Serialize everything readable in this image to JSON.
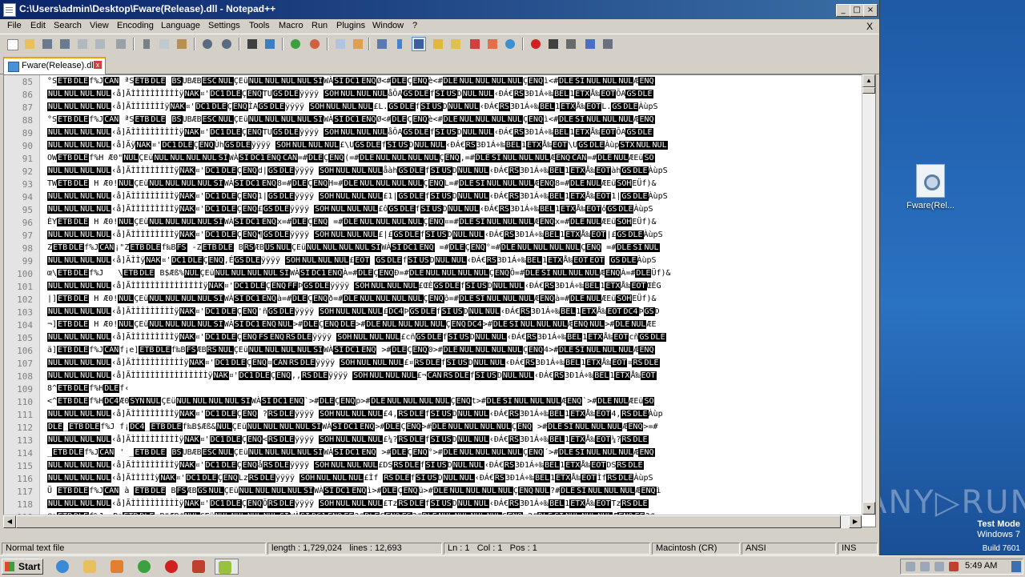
{
  "window": {
    "title": "C:\\Users\\admin\\Desktop\\Fware(Release).dll - Notepad++",
    "minimize": "_",
    "maximize": "□",
    "close": "×"
  },
  "menu": {
    "items": [
      "File",
      "Edit",
      "Search",
      "View",
      "Encoding",
      "Language",
      "Settings",
      "Tools",
      "Macro",
      "Run",
      "Plugins",
      "Window",
      "?"
    ],
    "close_doc": "X"
  },
  "toolbar": {
    "icons": [
      "new-file-icon",
      "open-file-icon",
      "save-icon",
      "save-all-icon",
      "close-icon",
      "close-all-icon",
      "print-icon",
      "cut-icon",
      "copy-icon",
      "paste-icon",
      "undo-icon",
      "redo-icon",
      "find-icon",
      "replace-icon",
      "zoom-in-icon",
      "zoom-out-icon",
      "sync-v-icon",
      "sync-h-icon",
      "wrap-icon",
      "all-chars-icon",
      "indent-guide-icon",
      "udl-icon",
      "doc-map-icon",
      "function-list-icon",
      "folder-workspace-icon",
      "monitor-icon",
      "record-macro-icon",
      "stop-record-icon",
      "play-macro-icon",
      "run-multiple-icon",
      "save-macro-icon"
    ]
  },
  "tab": {
    "name": "Fware(Release).dll",
    "close": "x"
  },
  "editor": {
    "line_numbers": [
      "85",
      "86",
      "87",
      "88",
      "89",
      "90",
      "91",
      "92",
      "93",
      "94",
      "95",
      "96",
      "97",
      "98",
      "99",
      "100",
      "101",
      "102",
      "103",
      "104",
      "105",
      "106",
      "107",
      "108",
      "109",
      "110",
      "111",
      "112",
      "113",
      "114",
      "115",
      "116",
      "117",
      "118",
      "119"
    ],
    "lines": [
      "°SETBDLEf%JCAN ªSETBDLE BSUBÆBESCNULÇEüNULNULNULNULSIWÀSIDC1ENQØ<#DLEÇENQè<#DLENULNULNULNULÇENQì<#DLESINULNULNULÆENQ",
      "NULNULNULNUL‹å]ÃÌÌÌÌÌÌÌÌÌÌÿNAK¤'DC1DLEÇENQTUGSDLEÿÿÿÿ SOHNULNULNULåÔAGSDLEfSIUSDNULNUL‹ÐÁ€RS3Ð1Á÷‰BEL1ETXÅ‰EOTÔAGSDLE",
      "NULNULNULNUL‹å]ÃÌÌÌÌÌÌÌÿNAK¤'DC1DLEÇENQÌAGSDLEÿÿÿÿ SOHNULNULNUL£L.GSDLEfSIUSDNULNUL‹ÐÁ€RS3Ð1Á÷‰BEL1ETXÅ‰EOTL.GSDLEÀùpS",
      "°SETBDLEf%JCAN ªSETBDLE BSUBÆBESCNULÇEüNULNULNULNULSIWÀSIDC1ENQØ<#DLEÇENQè<#DLENULNULNULNULÇENQì<#DLESINULNULNULÆENQ",
      "NULNULNULNUL‹å]ÃÌÌÌÌÌÌÌÌÌÌÿNAK¤'DC1DLEÇENQTUGSDLEÿÿÿÿ SOHNULNULNULåÔAGSDLEfSIUSDNULNUL‹ÐÁ€RS3Ð1Á÷‰BEL1ETXÅ‰EOTÔAGSDLE",
      "NULNULNULNUL‹å]ÃÿNAK¤'DC1DLEÇENQÙhGSDLEÿÿÿÿ SOHNULNULNUL£\\UGSDLEfSIUSDNULNUL‹ÐÁ€RS3Ð1Á÷‰BEL1ETXÅ‰EOT\\UGSDLEÀùpSTXNULNUL",
      "OWETBDLEf%H Æ0\"NULÇEüNULNULNULNULSIWÀSIDC1ENQCAN=#DLEÇENQ(=#DLENULNULNULNULÇENQ,=#DLESINULNULNULÆENQCAN=#DLENULÆEüSO",
      "NULNULNULNUL‹å]ÃÌÌÌÌÌÌÌÌÌÿNAK¤'DC1DLEÇENQd|GSDLEÿÿÿÿ SOHNULNULNULåàhGSDLEfSIUSDNULNUL‹ÐÁ€RS3Ð1Á÷‰BEL1ETXÅ‰EOTàhGSDLEÀùpS",
      "TWETBDLE H Æ0!NULÇEüNULNULNULNULSIWÀSIDC1ENQ8=#DLEÇENQH=#DLENULNULNULNULÇENQL=#DLESINULNULNULÆENQ8=#DLENULÆEüSOHEÜf)&",
      "NULNULNULNUL‹å]ÃÌÌÌÌÌÌÌÌÌÿNAK¤'DC1DLEÇENQ1|GSDLEÿÿÿÿ SOHNULNULNUL£1|GSDLEfSIUSDNULNUL‹ÐÁ€RS3Ð1Á÷‰BEL1ETXÅ‰EOT1|GSDLEÀùpS",
      "NULNULNULNUL‹å]ÃÌÌÌÌÌÌÌÌÌÿNAK¤'DC1DLEÇENQ£GSDLEÿÿÿÿ SOHNULNULNUL£ôGSDLEfSIUSDNULNUL‹ÐÁ€RS3Ð1Á÷‰BEL1ETXÅ‰EOTôGSDLEÀùpS",
      "ÈYETBDLE H Æ0!NULÇEüNULNULNULNULSIWÀSIDC1ENQx=#DLEÇENQ =#DLENULNULNULNULÇENQ¤=#DLESINULNULNULÆENQx=#DLENULÆEüSOHEÜf)&",
      "NULNULNULNUL‹å]ÃÌÌÌÌÌÌÌÌÌÿNAK¤'DC1DLEÇENQ¶GSDLEÿÿÿÿ SOHNULNULNUL£|£GSDLEfSIUSDNULNUL‹ÐÁ€RS3Ð1Á÷‰BEL1ETXÅ‰EOT|£GSDLEÀùpS",
      "ZETBDLEf%JCAN¡\"ZETBDLEf‰BFS -ZETBDLE BRSÆBUSNULÇEüNULNULNULNULSIWÀSIDC1ENQ =#DLEÇENQ°=#DLENULNULNULNULÇENQ =#DLESINUL",
      "NULNULNULNUL‹å]ÃÌÌÿNAK¤'DC1DLEÇENQ,ÉGSDLEÿÿÿÿ SOHNULNULNUL£EOT GSDLEfSIUSDNULNUL‹ÐÁ€RS3Ð1Á÷‰BEL1ETXÅ‰EOTEOT GSDLEÀùpS",
      "œ\\ETBDLEf%J   \\ETBDLE B$Æß%NULÇEüNULNULNULNULSIWÀSIDC1ENQÀ=#DLEÇENQÐ=#DLENULNULNULNULÇENQÔ=#DLESINULNULNULÆENQÀ=#DLEÜf)&",
      "NULNULNULNUL‹å]ÃÌÌÌÌÌÌÌÌÌÌÌÌÌÌÌÿNAK¤'DC1DLEÇENQFFÞGSDLEÿÿÿÿ SOHNULNULNUL£ŒÈGSDLEfSIUSDNULNUL‹ÐÁ€RS3Ð1Á÷‰BEL1ETXÅ‰EOTŒÈG",
      "|]ETBDLE H Æ0!NULÇEüNULNULNULNULSIWÀSIDC1ENQà=#DLEÇENQð=#DLENULNULNULNULÇENQô=#DLESINULNULNULÆENQà=#DLENULÆEüSOHEÜf)&",
      "NULNULNULNUL‹å]ÃÌÌÌÌÌÌÌÌÌÿNAK¤'DC1DLEÇENQ'ñGSDLEÿÿÿÿ SOHNULNULNUL£DC4ÞGSDLEfSIUSDNULNUL‹ÐÁ€RS3Ð1Á÷‰BEL1ETXÅ‰EOTDC4ÞGSD",
      "¬]ETBDLE H Æ0!NULÇEüNULNULNULNULSIWÀSIDC1ENQNUL>#DLEÇENQDLE>#DLENULNULNULNULÇENQDC4>#DLESINULNULNULÆENQNUL>#DLENULÆE",
      "NULNULNULNUL‹å]ÃÌÌÌÌÌÌÌÌÌÿNAK¤'DC1DLEÇENQFSENQRSDLEÿÿÿÿ SOHNULNULNUL£cñGSDLEfSIUSDNULNUL‹ÐÁ€RS3Ð1Á÷‰BEL1ETXÅ‰EOTcñGSDLE",
      "ä]ETBDLEf%JCANf¡e]ETBDLEf‰BFSÆBRSNULÇEüNULNULNULNULSIWÀSIDC1ENQ >#DLEÇENQ0>#DLENULNULNULNULÇENQ4>#DLESINULNULNULÆENQ",
      "NULNULNULNUL‹å]ÃÌÌÌÌÌÌÌÌÌÌÌÿNAK¤'DC1DLEÇENQ¤CANRSDLEÿÿÿÿ SOHNULNULNUL£¤RSDLEfSIUSDNULNUL‹ÐÁ€RS3Ð1Á÷‰BEL1ETXÅ‰EOT¤RSDLE",
      "NULNULNULNUL‹å]ÃÌÌÌÌÌÌÌÌÌÌÌÌÌÌÌÌÿNAK¤'DC1DLEÇENQ,,RSDLEÿÿÿÿ SOHNULNULNUL£¬CANRSDLEfSIUSDNULNUL‹ÐÁ€RS3Ð1Á÷‰BEL1ETXÅ‰EOT",
      "8^ETBDLEf%HDLEf‹",
      "<^ETBDLEf%HDC4Æ0SYNNULÇEüNULNULNULNULSIWÀSIDC1ENQ`>#DLEÇENQp>#DLENULNULNULNULÇENQt>#DLESINULNULNULÆENQ`>#DLENULÆEüSO",
      "NULNULNULNUL‹å]ÃÌÌÌÌÌÌÌÌÌÿNAK¤'DC1DLEÇENQ ?RSDLEÿÿÿÿ SOHNULNULNUL£4,RSDLEfSIUSDNULNUL‹ÐÁ€RS3Ð1Á÷‰BEL1ETXÅ‰EOT4,RSDLEÀùp",
      "DLE_ETBDLEf%J f¡DC4_ETBDLEf‰B$Æß&NULÇEüNULNULNULNULSIWÀSIDC1ENQ>#DLEÇENQ>#DLENULNULNULNULÇENQ >#DLESINULNULNULÆENQ>=#",
      "NULNULNULNUL‹å]ÃÌÌÌÌÌÌÌÌÌÌÿNAK¤'DC1DLEÇENQ<RSDLEÿÿÿÿ SOHNULNULNUL£¼?RSDLEfSIUSDNULNUL‹ÐÁ€RS3Ð1Á÷‰BEL1ETXÅ‰EOT¼?RSDLE",
      "_ETBDLEf%JCAN ' _ETBDLE BSUBÆBESCNULÇEüNULNULNULNULSIWÀSIDC1ENQ >#DLEÇENQ°>#DLENULNULNULNULÇENQ´>#DLESINULNULNULÆENQ",
      "NULNULNULNUL‹å]ÃÌÌÌÌÌÌÌÌÌÿNAK¤'DC1DLEÇENQåRSDLEÿÿÿÿ SOHNULNULNUL£DSRSDLEfSIUSDNULNUL‹ÐÁ€RS3Ð1Á÷‰BEL1ETXÅ‰EOTDSRSDLE",
      "NULNULNULNUL‹å]ÃÌÌÌÌÌÿNAK¤'DC1DLEÇENQLzRSDLEÿÿÿÿ SOHNULNULNUL£Ìf RSDLEfSIUSDNULNUL‹ÐÁ€RS3Ð1Á÷‰BEL1ETXÅ‰EOTÌfRSDLEÀùpS",
      "Ü ETBDLEf%JCAN à ETBDLE BFSÆBGSNULÇEüNULNULNULNULSIWÀSIDC1ENQì>#DLEÇENQü>#DLENULNULNULNULÇENQNUL?#DLESINULNULNULÆENQì",
      "NULNULNULNUL‹å]ÃÌÌÌÌÌÌÌÌÌÌÿNAK¤'DC1DLEÇENQÕRSDLEÿÿÿÿ SOHNULNULNUL£TzRSDLEfSIUSDNULNUL‹ÐÁ€RS3Ð1Á÷‰BEL1ETXÅ‰EOTTzRSDLE",
      "@aETBDLEf%J  BaETBDLE B\"ÆB#NULÇEüNULNULNULNULSIWÀSIDC1ENQFF?#DLEÇENQFS?#DLENULNULNULNULÇENQ ?#DLESINULNULNULÆENQFF?#"
    ]
  },
  "statusbar": {
    "type": "Normal text file",
    "length": "length : 1,729,024",
    "lines": "lines : 12,693",
    "ln": "Ln : 1",
    "col": "Col : 1",
    "pos": "Pos : 1",
    "eol": "Macintosh (CR)",
    "encoding": "ANSI",
    "ins": "INS"
  },
  "desktop": {
    "icon_label": "Fware(Rel...",
    "watermark_line1": "Test Mode",
    "watermark_line2": "Windows 7",
    "watermark_line3": "Build 7601",
    "brand": "ANY RUN"
  },
  "taskbar": {
    "start_label": "Start",
    "clock": "5:49 AM"
  }
}
